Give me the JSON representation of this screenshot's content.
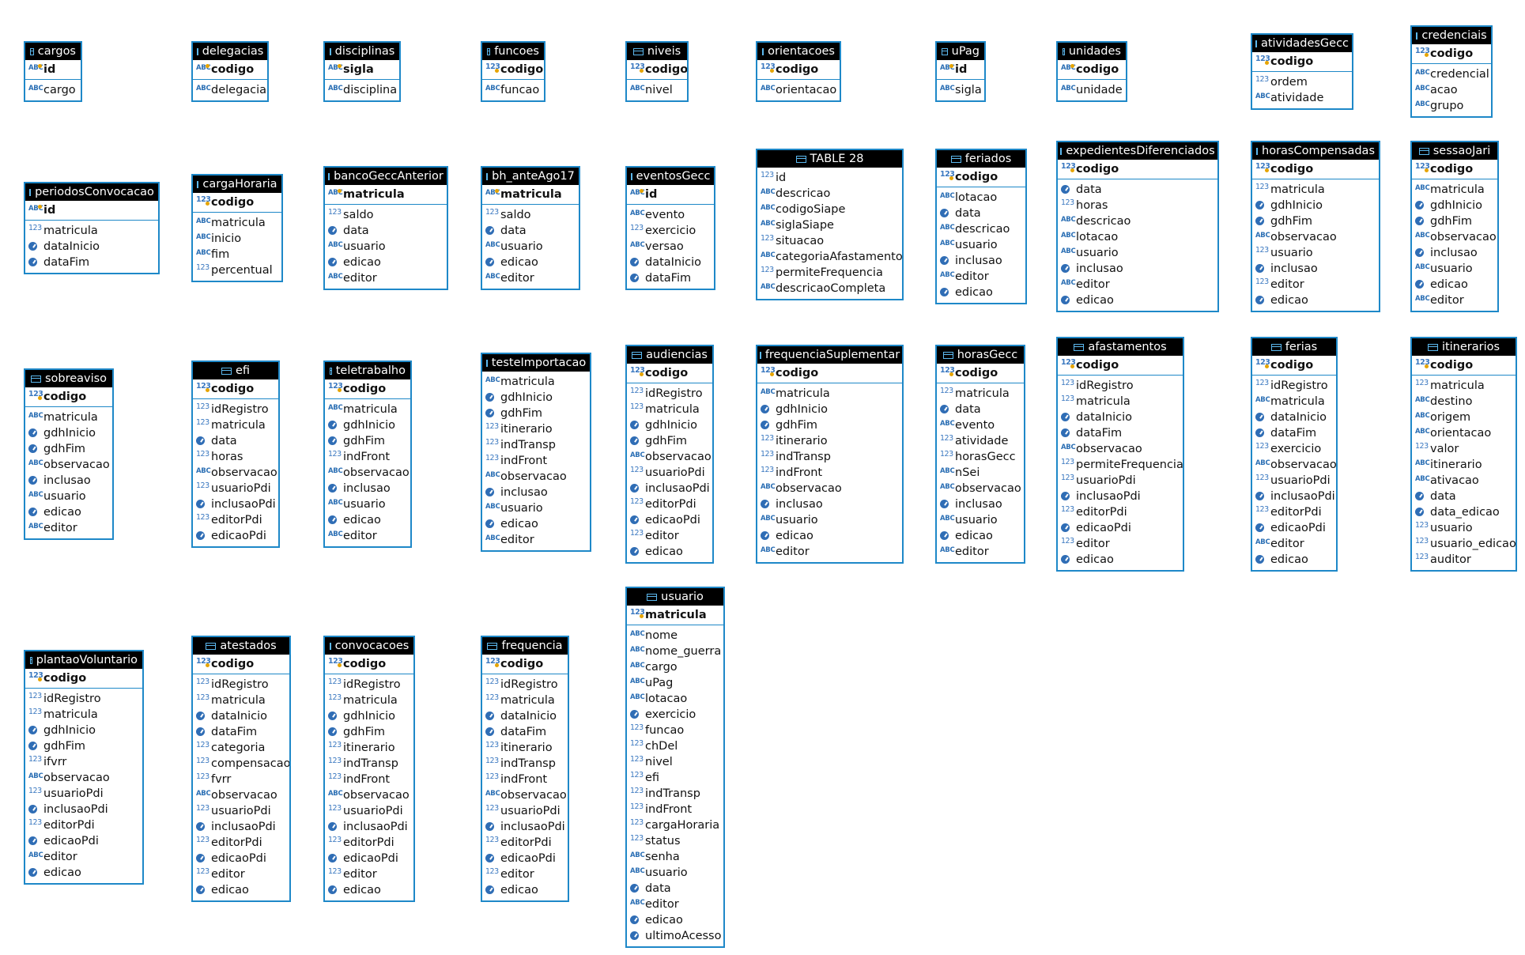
{
  "tables": [
    {
      "name": "cargos",
      "pk": "id",
      "pk_type": "txt",
      "cols": [
        [
          "txt",
          "cargo"
        ]
      ]
    },
    {
      "name": "delegacias",
      "pk": "codigo",
      "pk_type": "txt",
      "cols": [
        [
          "txt",
          "delegacia"
        ]
      ]
    },
    {
      "name": "disciplinas",
      "pk": "sigla",
      "pk_type": "txt",
      "cols": [
        [
          "txt",
          "disciplina"
        ]
      ]
    },
    {
      "name": "funcoes",
      "pk": "codigo",
      "pk_type": "num",
      "cols": [
        [
          "txt",
          "funcao"
        ]
      ]
    },
    {
      "name": "niveis",
      "pk": "codigo",
      "pk_type": "num",
      "cols": [
        [
          "txt",
          "nivel"
        ]
      ]
    },
    {
      "name": "orientacoes",
      "pk": "codigo",
      "pk_type": "num",
      "cols": [
        [
          "txt",
          "orientacao"
        ]
      ]
    },
    {
      "name": "uPag",
      "pk": "id",
      "pk_type": "txt",
      "cols": [
        [
          "txt",
          "sigla"
        ]
      ]
    },
    {
      "name": "unidades",
      "pk": "codigo",
      "pk_type": "txt",
      "cols": [
        [
          "txt",
          "unidade"
        ]
      ]
    },
    {
      "name": "atividadesGecc",
      "pk": "codigo",
      "pk_type": "num",
      "cols": [
        [
          "num",
          "ordem"
        ],
        [
          "txt",
          "atividade"
        ]
      ]
    },
    {
      "name": "credenciais",
      "pk": "codigo",
      "pk_type": "num",
      "cols": [
        [
          "txt",
          "credencial"
        ],
        [
          "txt",
          "acao"
        ],
        [
          "txt",
          "grupo"
        ]
      ]
    },
    {
      "name": "periodosConvocacao",
      "pk": "id",
      "pk_type": "txt",
      "cols": [
        [
          "num",
          "matricula"
        ],
        [
          "date",
          "dataInicio"
        ],
        [
          "date",
          "dataFim"
        ]
      ]
    },
    {
      "name": "cargaHoraria",
      "pk": "codigo",
      "pk_type": "num",
      "cols": [
        [
          "txt",
          "matricula"
        ],
        [
          "txt",
          "inicio"
        ],
        [
          "txt",
          "fim"
        ],
        [
          "num",
          "percentual"
        ]
      ]
    },
    {
      "name": "bancoGeccAnterior",
      "pk": "matricula",
      "pk_type": "txt",
      "cols": [
        [
          "num",
          "saldo"
        ],
        [
          "date",
          "data"
        ],
        [
          "txt",
          "usuario"
        ],
        [
          "date",
          "edicao"
        ],
        [
          "txt",
          "editor"
        ]
      ]
    },
    {
      "name": "bh_anteAgo17",
      "pk": "matricula",
      "pk_type": "txt",
      "cols": [
        [
          "num",
          "saldo"
        ],
        [
          "date",
          "data"
        ],
        [
          "txt",
          "usuario"
        ],
        [
          "date",
          "edicao"
        ],
        [
          "txt",
          "editor"
        ]
      ]
    },
    {
      "name": "eventosGecc",
      "pk": "id",
      "pk_type": "txt",
      "cols": [
        [
          "txt",
          "evento"
        ],
        [
          "num",
          "exercicio"
        ],
        [
          "txt",
          "versao"
        ],
        [
          "date",
          "dataInicio"
        ],
        [
          "date",
          "dataFim"
        ]
      ]
    },
    {
      "name": "TABLE 28",
      "pk": null,
      "pk_type": null,
      "cols": [
        [
          "num",
          "id"
        ],
        [
          "txt",
          "descricao"
        ],
        [
          "txt",
          "codigoSiape"
        ],
        [
          "txt",
          "siglaSiape"
        ],
        [
          "num",
          "situacao"
        ],
        [
          "txt",
          "categoriaAfastamento"
        ],
        [
          "num",
          "permiteFrequencia"
        ],
        [
          "txt",
          "descricaoCompleta"
        ]
      ]
    },
    {
      "name": "feriados",
      "pk": "codigo",
      "pk_type": "num",
      "cols": [
        [
          "txt",
          "lotacao"
        ],
        [
          "date",
          "data"
        ],
        [
          "txt",
          "descricao"
        ],
        [
          "txt",
          "usuario"
        ],
        [
          "date",
          "inclusao"
        ],
        [
          "txt",
          "editor"
        ],
        [
          "date",
          "edicao"
        ]
      ]
    },
    {
      "name": "expedientesDiferenciados",
      "pk": "codigo",
      "pk_type": "num",
      "cols": [
        [
          "date",
          "data"
        ],
        [
          "num",
          "horas"
        ],
        [
          "txt",
          "descricao"
        ],
        [
          "txt",
          "lotacao"
        ],
        [
          "txt",
          "usuario"
        ],
        [
          "date",
          "inclusao"
        ],
        [
          "txt",
          "editor"
        ],
        [
          "date",
          "edicao"
        ]
      ]
    },
    {
      "name": "horasCompensadas",
      "pk": "codigo",
      "pk_type": "num",
      "cols": [
        [
          "num",
          "matricula"
        ],
        [
          "date",
          "gdhInicio"
        ],
        [
          "date",
          "gdhFim"
        ],
        [
          "txt",
          "observacao"
        ],
        [
          "num",
          "usuario"
        ],
        [
          "date",
          "inclusao"
        ],
        [
          "num",
          "editor"
        ],
        [
          "date",
          "edicao"
        ]
      ]
    },
    {
      "name": "sessaoJari",
      "pk": "codigo",
      "pk_type": "num",
      "cols": [
        [
          "txt",
          "matricula"
        ],
        [
          "date",
          "gdhInicio"
        ],
        [
          "date",
          "gdhFim"
        ],
        [
          "txt",
          "observacao"
        ],
        [
          "date",
          "inclusao"
        ],
        [
          "txt",
          "usuario"
        ],
        [
          "date",
          "edicao"
        ],
        [
          "txt",
          "editor"
        ]
      ]
    },
    {
      "name": "sobreaviso",
      "pk": "codigo",
      "pk_type": "num",
      "cols": [
        [
          "txt",
          "matricula"
        ],
        [
          "date",
          "gdhInicio"
        ],
        [
          "date",
          "gdhFim"
        ],
        [
          "txt",
          "observacao"
        ],
        [
          "date",
          "inclusao"
        ],
        [
          "txt",
          "usuario"
        ],
        [
          "date",
          "edicao"
        ],
        [
          "txt",
          "editor"
        ]
      ]
    },
    {
      "name": "efi",
      "pk": "codigo",
      "pk_type": "num",
      "cols": [
        [
          "num",
          "idRegistro"
        ],
        [
          "num",
          "matricula"
        ],
        [
          "date",
          "data"
        ],
        [
          "num",
          "horas"
        ],
        [
          "txt",
          "observacao"
        ],
        [
          "num",
          "usuarioPdi"
        ],
        [
          "date",
          "inclusaoPdi"
        ],
        [
          "num",
          "editorPdi"
        ],
        [
          "date",
          "edicaoPdi"
        ]
      ]
    },
    {
      "name": "teletrabalho",
      "pk": "codigo",
      "pk_type": "num",
      "cols": [
        [
          "txt",
          "matricula"
        ],
        [
          "date",
          "gdhInicio"
        ],
        [
          "date",
          "gdhFim"
        ],
        [
          "num",
          "indFront"
        ],
        [
          "txt",
          "observacao"
        ],
        [
          "date",
          "inclusao"
        ],
        [
          "txt",
          "usuario"
        ],
        [
          "date",
          "edicao"
        ],
        [
          "txt",
          "editor"
        ]
      ]
    },
    {
      "name": "testeImportacao",
      "pk": null,
      "pk_type": null,
      "cols": [
        [
          "txt",
          "matricula"
        ],
        [
          "date",
          "gdhInicio"
        ],
        [
          "date",
          "gdhFim"
        ],
        [
          "num",
          "itinerario"
        ],
        [
          "num",
          "indTransp"
        ],
        [
          "num",
          "indFront"
        ],
        [
          "txt",
          "observacao"
        ],
        [
          "date",
          "inclusao"
        ],
        [
          "txt",
          "usuario"
        ],
        [
          "date",
          "edicao"
        ],
        [
          "txt",
          "editor"
        ]
      ]
    },
    {
      "name": "audiencias",
      "pk": "codigo",
      "pk_type": "num",
      "cols": [
        [
          "num",
          "idRegistro"
        ],
        [
          "num",
          "matricula"
        ],
        [
          "date",
          "gdhInicio"
        ],
        [
          "date",
          "gdhFim"
        ],
        [
          "txt",
          "observacao"
        ],
        [
          "num",
          "usuarioPdi"
        ],
        [
          "date",
          "inclusaoPdi"
        ],
        [
          "num",
          "editorPdi"
        ],
        [
          "date",
          "edicaoPdi"
        ],
        [
          "num",
          "editor"
        ],
        [
          "date",
          "edicao"
        ]
      ]
    },
    {
      "name": "frequenciaSuplementar",
      "pk": "codigo",
      "pk_type": "num",
      "cols": [
        [
          "txt",
          "matricula"
        ],
        [
          "date",
          "gdhInicio"
        ],
        [
          "date",
          "gdhFim"
        ],
        [
          "num",
          "itinerario"
        ],
        [
          "num",
          "indTransp"
        ],
        [
          "num",
          "indFront"
        ],
        [
          "txt",
          "observacao"
        ],
        [
          "date",
          "inclusao"
        ],
        [
          "txt",
          "usuario"
        ],
        [
          "date",
          "edicao"
        ],
        [
          "txt",
          "editor"
        ]
      ]
    },
    {
      "name": "horasGecc",
      "pk": "codigo",
      "pk_type": "num",
      "cols": [
        [
          "num",
          "matricula"
        ],
        [
          "date",
          "data"
        ],
        [
          "txt",
          "evento"
        ],
        [
          "num",
          "atividade"
        ],
        [
          "num",
          "horasGecc"
        ],
        [
          "txt",
          "nSei"
        ],
        [
          "txt",
          "observacao"
        ],
        [
          "date",
          "inclusao"
        ],
        [
          "txt",
          "usuario"
        ],
        [
          "date",
          "edicao"
        ],
        [
          "txt",
          "editor"
        ]
      ]
    },
    {
      "name": "afastamentos",
      "pk": "codigo",
      "pk_type": "num",
      "cols": [
        [
          "num",
          "idRegistro"
        ],
        [
          "num",
          "matricula"
        ],
        [
          "date",
          "dataInicio"
        ],
        [
          "date",
          "dataFim"
        ],
        [
          "txt",
          "observacao"
        ],
        [
          "num",
          "permiteFrequencia"
        ],
        [
          "num",
          "usuarioPdi"
        ],
        [
          "date",
          "inclusaoPdi"
        ],
        [
          "num",
          "editorPdi"
        ],
        [
          "date",
          "edicaoPdi"
        ],
        [
          "num",
          "editor"
        ],
        [
          "date",
          "edicao"
        ]
      ]
    },
    {
      "name": "ferias",
      "pk": "codigo",
      "pk_type": "num",
      "cols": [
        [
          "num",
          "idRegistro"
        ],
        [
          "txt",
          "matricula"
        ],
        [
          "date",
          "dataInicio"
        ],
        [
          "date",
          "dataFim"
        ],
        [
          "num",
          "exercicio"
        ],
        [
          "txt",
          "observacao"
        ],
        [
          "num",
          "usuarioPdi"
        ],
        [
          "date",
          "inclusaoPdi"
        ],
        [
          "num",
          "editorPdi"
        ],
        [
          "date",
          "edicaoPdi"
        ],
        [
          "txt",
          "editor"
        ],
        [
          "date",
          "edicao"
        ]
      ]
    },
    {
      "name": "itinerarios",
      "pk": "codigo",
      "pk_type": "num",
      "cols": [
        [
          "num",
          "matricula"
        ],
        [
          "txt",
          "destino"
        ],
        [
          "txt",
          "origem"
        ],
        [
          "txt",
          "orientacao"
        ],
        [
          "num",
          "valor"
        ],
        [
          "txt",
          "itinerario"
        ],
        [
          "txt",
          "ativacao"
        ],
        [
          "date",
          "data"
        ],
        [
          "date",
          "data_edicao"
        ],
        [
          "num",
          "usuario"
        ],
        [
          "num",
          "usuario_edicao"
        ],
        [
          "num",
          "auditor"
        ]
      ]
    },
    {
      "name": "usuario",
      "pk": "matricula",
      "pk_type": "num",
      "cols": [
        [
          "txt",
          "nome"
        ],
        [
          "txt",
          "nome_guerra"
        ],
        [
          "txt",
          "cargo"
        ],
        [
          "txt",
          "uPag"
        ],
        [
          "txt",
          "lotacao"
        ],
        [
          "date",
          "exercicio"
        ],
        [
          "num",
          "funcao"
        ],
        [
          "num",
          "chDel"
        ],
        [
          "num",
          "nivel"
        ],
        [
          "num",
          "efi"
        ],
        [
          "num",
          "indTransp"
        ],
        [
          "num",
          "indFront"
        ],
        [
          "num",
          "cargaHoraria"
        ],
        [
          "num",
          "status"
        ],
        [
          "txt",
          "senha"
        ],
        [
          "txt",
          "usuario"
        ],
        [
          "date",
          "data"
        ],
        [
          "txt",
          "editor"
        ],
        [
          "date",
          "edicao"
        ],
        [
          "date",
          "ultimoAcesso"
        ]
      ]
    },
    {
      "name": "plantaoVoluntario",
      "pk": "codigo",
      "pk_type": "num",
      "cols": [
        [
          "num",
          "idRegistro"
        ],
        [
          "num",
          "matricula"
        ],
        [
          "date",
          "gdhInicio"
        ],
        [
          "date",
          "gdhFim"
        ],
        [
          "num",
          "ifvrr"
        ],
        [
          "txt",
          "observacao"
        ],
        [
          "num",
          "usuarioPdi"
        ],
        [
          "date",
          "inclusaoPdi"
        ],
        [
          "num",
          "editorPdi"
        ],
        [
          "date",
          "edicaoPdi"
        ],
        [
          "txt",
          "editor"
        ],
        [
          "date",
          "edicao"
        ]
      ]
    },
    {
      "name": "atestados",
      "pk": "codigo",
      "pk_type": "num",
      "cols": [
        [
          "num",
          "idRegistro"
        ],
        [
          "num",
          "matricula"
        ],
        [
          "date",
          "dataInicio"
        ],
        [
          "date",
          "dataFim"
        ],
        [
          "num",
          "categoria"
        ],
        [
          "num",
          "compensacao"
        ],
        [
          "num",
          "fvrr"
        ],
        [
          "txt",
          "observacao"
        ],
        [
          "num",
          "usuarioPdi"
        ],
        [
          "date",
          "inclusaoPdi"
        ],
        [
          "num",
          "editorPdi"
        ],
        [
          "date",
          "edicaoPdi"
        ],
        [
          "num",
          "editor"
        ],
        [
          "date",
          "edicao"
        ]
      ]
    },
    {
      "name": "convocacoes",
      "pk": "codigo",
      "pk_type": "num",
      "cols": [
        [
          "num",
          "idRegistro"
        ],
        [
          "num",
          "matricula"
        ],
        [
          "date",
          "gdhInicio"
        ],
        [
          "date",
          "gdhFim"
        ],
        [
          "num",
          "itinerario"
        ],
        [
          "num",
          "indTransp"
        ],
        [
          "num",
          "indFront"
        ],
        [
          "txt",
          "observacao"
        ],
        [
          "num",
          "usuarioPdi"
        ],
        [
          "date",
          "inclusaoPdi"
        ],
        [
          "num",
          "editorPdi"
        ],
        [
          "date",
          "edicaoPdi"
        ],
        [
          "num",
          "editor"
        ],
        [
          "date",
          "edicao"
        ]
      ]
    },
    {
      "name": "frequencia",
      "pk": "codigo",
      "pk_type": "num",
      "cols": [
        [
          "num",
          "idRegistro"
        ],
        [
          "num",
          "matricula"
        ],
        [
          "date",
          "dataInicio"
        ],
        [
          "date",
          "dataFim"
        ],
        [
          "num",
          "itinerario"
        ],
        [
          "num",
          "indTransp"
        ],
        [
          "num",
          "indFront"
        ],
        [
          "txt",
          "observacao"
        ],
        [
          "num",
          "usuarioPdi"
        ],
        [
          "date",
          "inclusaoPdi"
        ],
        [
          "num",
          "editorPdi"
        ],
        [
          "date",
          "edicaoPdi"
        ],
        [
          "num",
          "editor"
        ],
        [
          "date",
          "edicao"
        ]
      ]
    }
  ],
  "icon_labels": {
    "num": "123",
    "txt": "ABC"
  },
  "colors": {
    "border": "#1e88c8",
    "header_bg": "#000000",
    "header_text": "#ffffff",
    "type_icon": "#2f6db5"
  }
}
